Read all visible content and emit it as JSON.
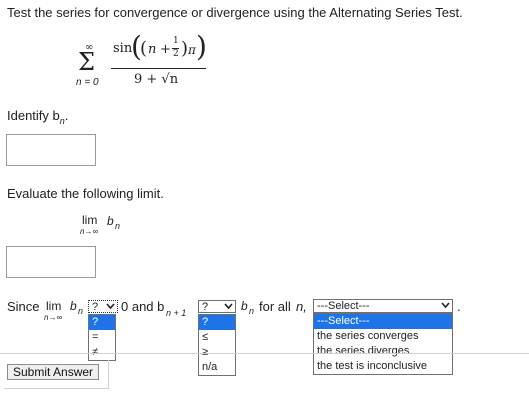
{
  "question": "Test the series for convergence or divergence using the Alternating Series Test.",
  "series": {
    "sigma": "Σ",
    "upper": "∞",
    "lower": "n = 0",
    "num_func": "sin",
    "num_inner_open": "(",
    "num_n": "n",
    "num_plus": "+",
    "half_num": "1",
    "half_den": "2",
    "num_inner_close": ")",
    "pi": "π",
    "den": "9 + √n"
  },
  "identify": {
    "label": "Identify b",
    "sub": "n",
    "suffix": ".",
    "value": ""
  },
  "evaluate": {
    "label": "Evaluate the following limit.",
    "lim": "lim",
    "arrow": "n→∞",
    "b": "b",
    "sub": "n",
    "value": ""
  },
  "since": {
    "since_text": "Since",
    "lim": "lim",
    "arrow": "n→∞",
    "b": "b",
    "sub": "n",
    "zero_and": "0 and b",
    "sub2": "n + 1",
    "b2": "b",
    "sub3": "n",
    "for_all": "for all",
    "n": "n,",
    "period": "."
  },
  "select1": {
    "selected": "?",
    "options": [
      "?",
      "=",
      "≠"
    ]
  },
  "select2": {
    "selected": "?",
    "options": [
      "?",
      "≤",
      "≥",
      "n/a"
    ]
  },
  "select3": {
    "selected": "---Select---",
    "options": [
      "---Select---",
      "the series converges",
      "the series diverges",
      "the test is inconclusive"
    ]
  },
  "submit": {
    "label": "Submit Answer"
  },
  "colors": {
    "highlight": "#1e73e8",
    "border": "#9a9a9a"
  }
}
